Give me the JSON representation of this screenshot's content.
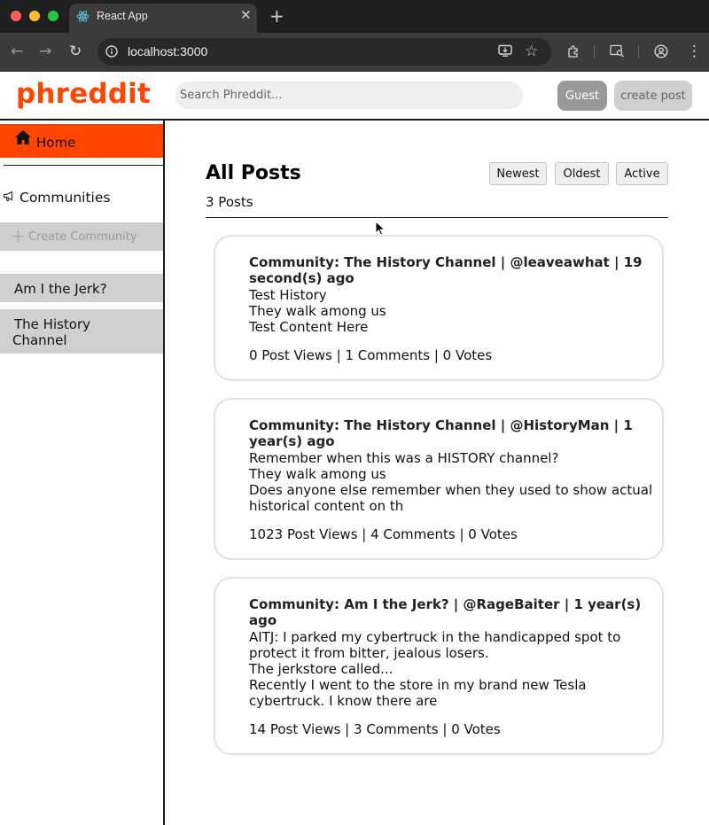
{
  "browser": {
    "tab_title": "React App",
    "url": "localhost:3000",
    "icons": [
      "back-icon",
      "forward-icon",
      "reload-icon",
      "site-info-icon",
      "install-app-icon",
      "bookmark-star-icon",
      "extensions-icon",
      "search-tabs-icon",
      "profile-icon",
      "menu-icon"
    ]
  },
  "header": {
    "logo": "phreddit",
    "search_placeholder": "Search Phreddit...",
    "guest_label": "Guest",
    "create_post_label": "create post",
    "accent": "#ff4500"
  },
  "sidebar": {
    "home_label": "Home",
    "communities_label": "Communities",
    "create_community_label": "Create Community",
    "communities": [
      {
        "name": "Am I the Jerk?"
      },
      {
        "name": "The History Channel"
      }
    ]
  },
  "main": {
    "title": "All Posts",
    "post_count": "3 Posts",
    "sort_buttons": [
      "Newest",
      "Oldest",
      "Active"
    ],
    "posts": [
      {
        "meta": "Community: The History Channel | @leaveawhat | 19 second(s) ago",
        "title": "Test History",
        "flair": "They walk among us",
        "content": "Test Content Here",
        "stats": "0 Post Views | 1 Comments | 0 Votes"
      },
      {
        "meta": "Community: The History Channel | @HistoryMan | 1 year(s) ago",
        "title": "Remember when this was a HISTORY channel?",
        "flair": "They walk among us",
        "content": "Does anyone else remember when they used to show actual historical content on th",
        "stats": "1023 Post Views | 4 Comments | 0 Votes"
      },
      {
        "meta": "Community: Am I the Jerk? | @RageBaiter | 1 year(s) ago",
        "title": "AITJ: I parked my cybertruck in the handicapped spot to protect it from bitter, jealous losers.",
        "flair": "The jerkstore called...",
        "content": "Recently I went to the store in my brand new Tesla cybertruck. I know there are",
        "stats": "14 Post Views | 3 Comments | 0 Votes"
      }
    ]
  }
}
